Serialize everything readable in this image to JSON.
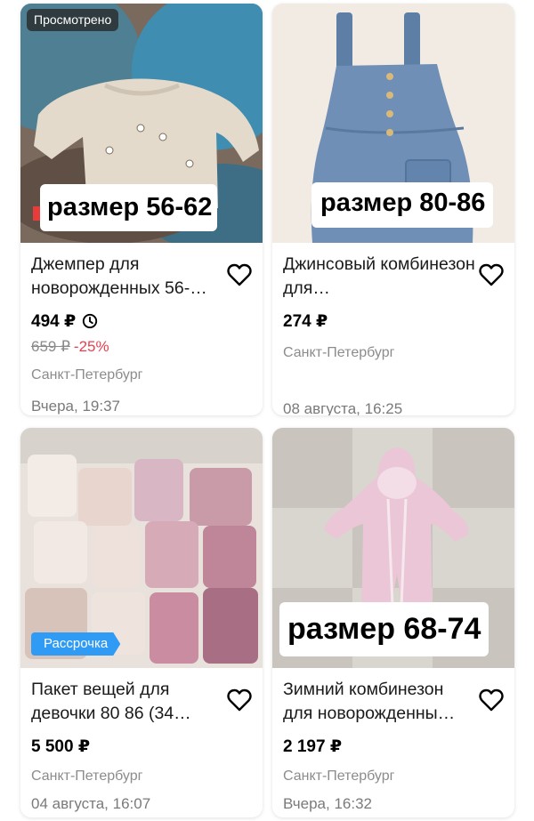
{
  "colors": {
    "accent_blue": "#2f9bf5",
    "discount_red": "#e8404f",
    "muted_text": "#8c8c8c"
  },
  "items": [
    {
      "badge": "Просмотрено",
      "size_label": "размер 56-62",
      "title": "Джемпер для новорожденных 56-…",
      "price": "494 ₽",
      "old_price": "659 ₽",
      "discount": "-25%",
      "city": "Санкт-Петербург",
      "date": "Вчера, 19:37",
      "icon": "heart-icon"
    },
    {
      "size_label": "размер 80-86",
      "title": "Джинсовый комбинезон для…",
      "price": "274 ₽",
      "city": "Санкт-Петербург",
      "date": "08 августа, 16:25",
      "icon": "heart-icon"
    },
    {
      "installment": "Рассрочка",
      "title": "Пакет вещей для девочки 80 86 (34…",
      "price": "5 500 ₽",
      "city": "Санкт-Петербург",
      "date": "04 августа, 16:07",
      "icon": "heart-icon"
    },
    {
      "size_label": "размер 68-74",
      "title": "Зимний комбинезон для новорожденны…",
      "price": "2 197 ₽",
      "city": "Санкт-Петербург",
      "date": "Вчера, 16:32",
      "icon": "heart-icon"
    }
  ]
}
